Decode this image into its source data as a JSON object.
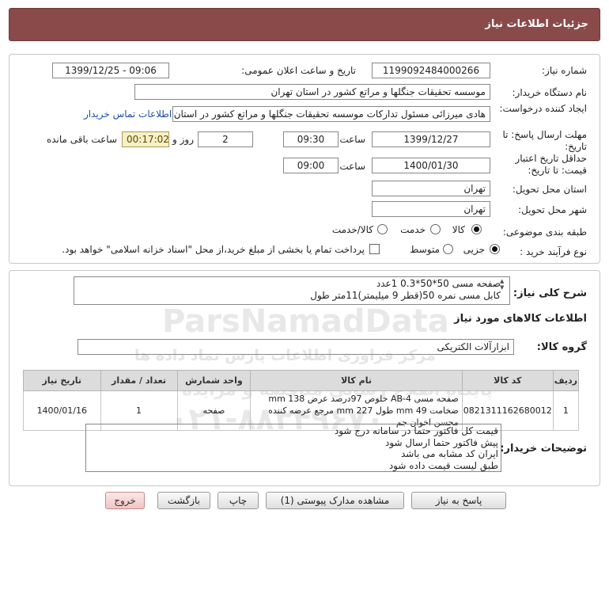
{
  "header": {
    "title": "جزئیات اطلاعات نیاز"
  },
  "form": {
    "need_number_label": "شماره نیاز:",
    "need_number": "1199092484000266",
    "announce_label": "تاریخ و ساعت اعلان عمومی:",
    "announce_value": "1399/12/25 - 09:06",
    "buyer_org_label": "نام دستگاه خریدار:",
    "buyer_org": "موسسه تحقیقات جنگلها و مراتع کشور در استان تهران",
    "requester_label": "ایجاد کننده درخواست:",
    "requester": "هادی میرزائی مسئول تدارکات موسسه تحقیقات جنگلها و مراتع کشور در استان تهران",
    "contact_link": "اطلاعات تماس خریدار",
    "reply_deadline_label": "مهلت ارسال پاسخ: تا تاریخ:",
    "reply_date": "1399/12/27",
    "time_label": "ساعت",
    "reply_time": "09:30",
    "days_value": "2",
    "days_label": "روز و",
    "remaining_time": "00:17:02",
    "remaining_label": "ساعت باقی مانده",
    "validity_label": "حداقل تاریخ اعتبار قیمت: تا تاریخ:",
    "validity_date": "1400/01/30",
    "validity_time": "09:00",
    "province_label": "استان محل تحویل:",
    "province": "تهران",
    "city_label": "شهر محل تحویل:",
    "city": "تهران",
    "category_label": "طبقه بندی موضوعی:",
    "category_options": [
      "کالا",
      "خدمت",
      "کالا/خدمت"
    ],
    "purchase_type_label": "نوع فرآیند خرید :",
    "purchase_options": [
      "جزیی",
      "متوسط"
    ],
    "payment_note": "پرداخت تمام یا بخشی از مبلغ خرید،از محل \"اسناد خزانه اسلامی\" خواهد بود."
  },
  "description": {
    "label": "شرح کلی نیاز:",
    "text": "صفحه مسی 50*50*0.3 1عدد\nکابل مسی نمره 50(قطر 9 میلیمتر)11متر طول"
  },
  "goods": {
    "section_title": "اطلاعات کالاهای مورد نیاز",
    "group_label": "گروه کالا:",
    "group_value": "ابزارآلات الکتریکی",
    "columns": [
      "ردیف",
      "کد کالا",
      "نام کالا",
      "واحد شمارش",
      "تعداد / مقدار",
      "تاریخ نیاز"
    ],
    "rows": [
      {
        "index": "1",
        "code": "0821311162680012",
        "name": "صفحه مسی AB-4 خلوص 97درصد عرض 138 mm ضخامت 49 mm طول 227 mm مرجع عرضه کننده محسن اخوان جم",
        "unit": "صفحه",
        "qty": "1",
        "date": "1400/01/16"
      }
    ]
  },
  "buyer_notes": {
    "label": "توضیحات خریدار:",
    "text": "قیمت کل فاکتور حتما در سامانه درج شود\nپیش فاکتور حتما ارسال شود\nایران کد مشابه می باشد\nطبق لیست قیمت داده شود"
  },
  "buttons": {
    "reply": "پاسخ به نیاز",
    "attachments": "مشاهده مدارک پیوستی (1)",
    "print": "چاپ",
    "back": "بازگشت",
    "exit": "خروج"
  },
  "watermark": {
    "brand": "ParsNamadData",
    "brand_fa": "مرکز فراوری اطلاعات پارس نماد داده ها",
    "side": "پایگاه اطلاع رسانی مناقصه و مزایده",
    "phone": "۰۲۱-۸۸۳۴۹۶۷۰"
  },
  "colors": {
    "titlebar": "#8a4a4a",
    "link": "#1f4fa6",
    "timer_bg": "#f6f0c7",
    "exit_button": "#f2c4c4"
  }
}
